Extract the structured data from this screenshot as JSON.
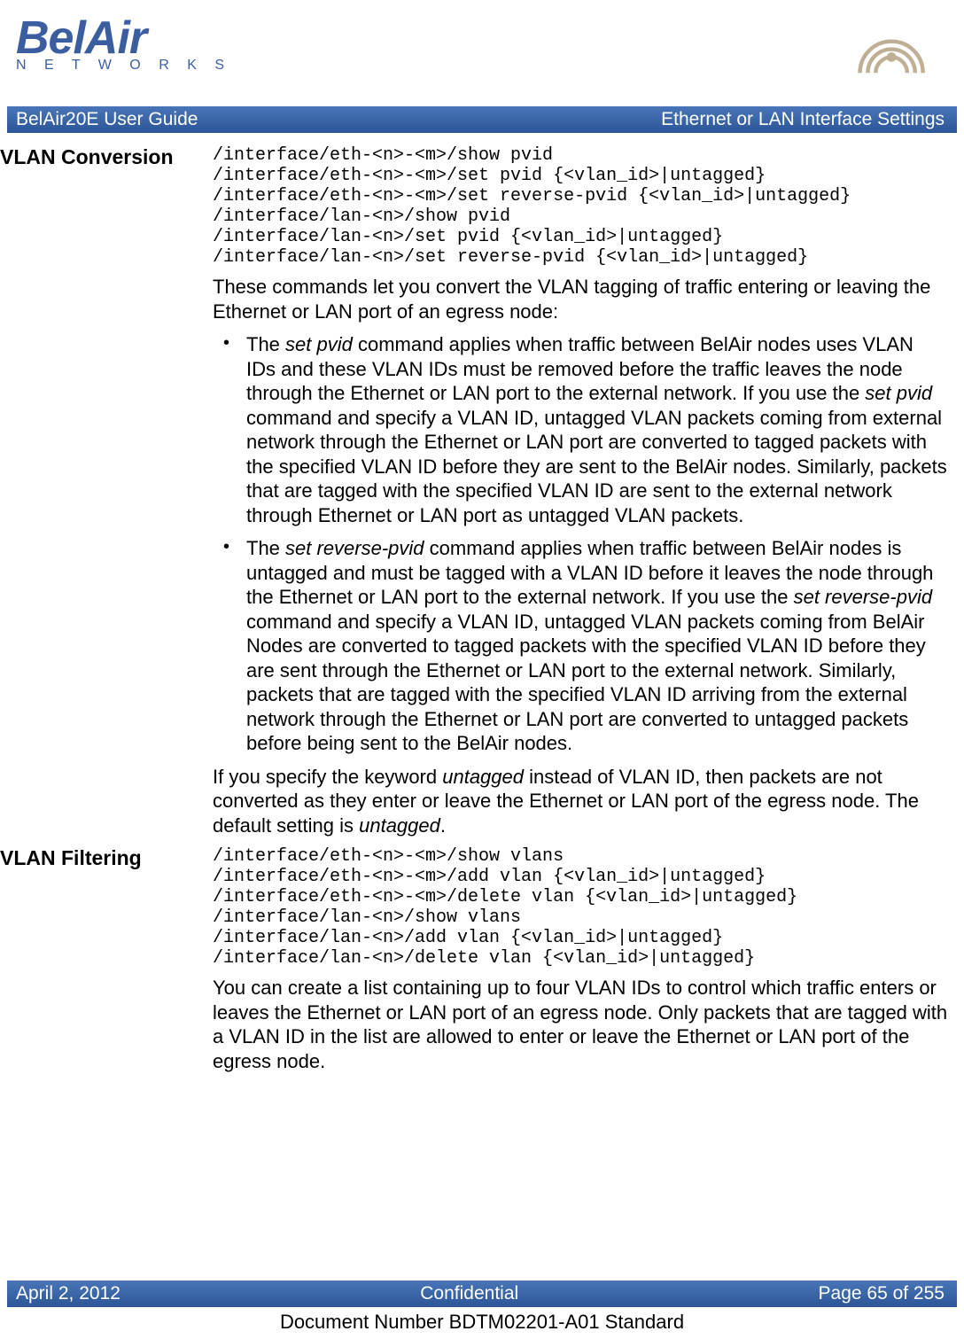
{
  "brand": {
    "name": "BelAir",
    "sub": "N E T W O R K S"
  },
  "titlebar": {
    "left": "BelAir20E User Guide",
    "right": "Ethernet or LAN Interface Settings"
  },
  "sections": {
    "vlan_conversion": {
      "heading": "VLAN Conversion",
      "cmds": "/interface/eth-<n>-<m>/show pvid\n/interface/eth-<n>-<m>/set pvid {<vlan_id>|untagged}\n/interface/eth-<n>-<m>/set reverse-pvid {<vlan_id>|untagged}\n/interface/lan-<n>/show pvid\n/interface/lan-<n>/set pvid {<vlan_id>|untagged}\n/interface/lan-<n>/set reverse-pvid {<vlan_id>|untagged}",
      "intro": "These commands let you convert the VLAN tagging of traffic entering or leaving the Ethernet or LAN port of an egress node:",
      "b1_a": "The ",
      "b1_cmd1": "set pvid",
      "b1_b": " command applies when traffic between BelAir nodes uses VLAN IDs and these VLAN IDs must be removed before the traffic leaves the node through the Ethernet or LAN port to the external network. If you use the ",
      "b1_cmd2": "set pvid",
      "b1_c": " command and specify a VLAN ID, untagged VLAN packets coming from external network through the Ethernet or LAN port are converted to tagged packets with the specified VLAN ID before they are sent to the BelAir nodes. Similarly, packets that are tagged with the specified VLAN ID are sent to the external network through Ethernet or LAN port as untagged VLAN packets.",
      "b2_a": "The ",
      "b2_cmd1": "set reverse-pvid",
      "b2_b": " command applies when traffic between BelAir nodes is untagged and must be tagged with a VLAN ID before it leaves the node through the Ethernet or LAN port to the external network. If you use the ",
      "b2_cmd2": "set reverse-pvid",
      "b2_c": " command and specify a VLAN ID, untagged VLAN packets coming from BelAir Nodes are converted to tagged packets with the specified VLAN ID before they are sent through the Ethernet or LAN port to the external network. Similarly, packets that are tagged with the specified VLAN ID arriving from the external network through the Ethernet or LAN port are converted to untagged packets before being sent to the BelAir nodes.",
      "tail_a": "If you specify the keyword ",
      "tail_kw1": "untagged",
      "tail_b": " instead of VLAN ID, then packets are not converted as they enter or leave the Ethernet or LAN port of the egress node. The default setting is ",
      "tail_kw2": "untagged",
      "tail_c": "."
    },
    "vlan_filtering": {
      "heading": "VLAN Filtering",
      "cmds": "/interface/eth-<n>-<m>/show vlans\n/interface/eth-<n>-<m>/add vlan {<vlan_id>|untagged}\n/interface/eth-<n>-<m>/delete vlan {<vlan_id>|untagged}\n/interface/lan-<n>/show vlans\n/interface/lan-<n>/add vlan {<vlan_id>|untagged}\n/interface/lan-<n>/delete vlan {<vlan_id>|untagged}",
      "para": "You can create a list containing up to four VLAN IDs to control which traffic enters or leaves the Ethernet or LAN port of an egress node. Only packets that are tagged with a VLAN ID in the list are allowed to enter or leave the Ethernet or LAN port of the egress node."
    }
  },
  "footer": {
    "date": "April 2, 2012",
    "center": "Confidential",
    "page": "Page 65 of 255",
    "docnum": "Document Number BDTM02201-A01 Standard"
  }
}
